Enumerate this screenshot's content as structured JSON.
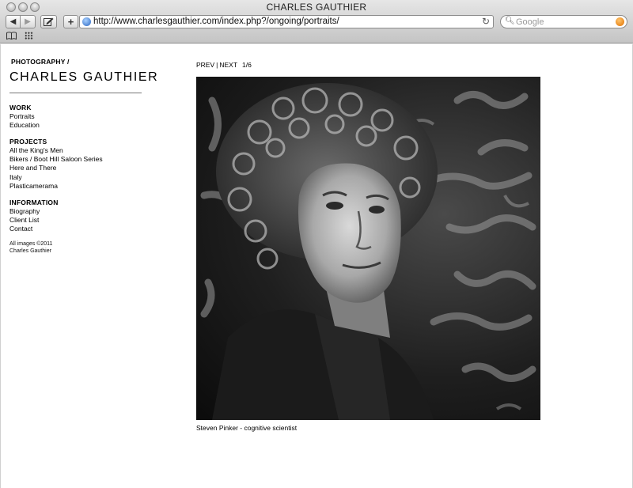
{
  "window": {
    "title": "CHARLES GAUTHIER"
  },
  "toolbar": {
    "url": "http://www.charlesgauthier.com/index.php?/ongoing/portraits/",
    "search_placeholder": "Google",
    "add_label": "+"
  },
  "site": {
    "kicker": "PHOTOGRAPHY /",
    "name": "CHARLES GAUTHIER"
  },
  "menu": {
    "work": {
      "heading": "WORK",
      "items": [
        "Portraits",
        "Education"
      ]
    },
    "projects": {
      "heading": "PROJECTS",
      "items": [
        "All the King's Men",
        "Bikers / Boot Hill Saloon Series",
        "Here and There",
        "Italy",
        "Plasticamerama"
      ]
    },
    "information": {
      "heading": "INFORMATION",
      "items": [
        "Biography",
        "Client List",
        "Contact"
      ]
    }
  },
  "copyright": {
    "line1": "All images ©2011",
    "line2": "Charles Gauthier"
  },
  "photo_nav": {
    "prev": "PREV",
    "separator": "|",
    "next": "NEXT",
    "count": "1/6"
  },
  "photo": {
    "caption": "Steven Pinker - cognitive scientist"
  },
  "icons": {
    "back": "back-arrow-icon",
    "forward": "forward-arrow-icon",
    "edit": "edit-icon",
    "add": "add-icon",
    "site": "globe-icon",
    "reload": "reload-icon",
    "search": "search-icon",
    "snapback": "snapback-icon",
    "bookmarks": "bookmarks-book-icon",
    "topsites": "grid-icon"
  },
  "colors": {
    "page_bg": "#ffffff",
    "text": "#000000",
    "chrome": "#d6d6d6"
  }
}
